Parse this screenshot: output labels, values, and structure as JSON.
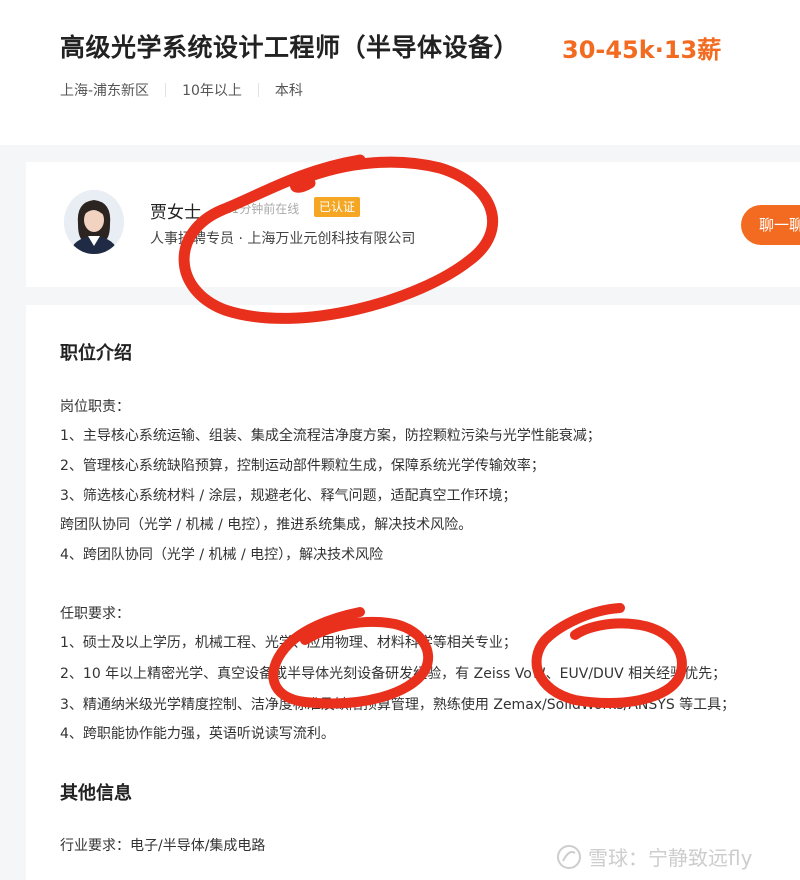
{
  "job": {
    "title": "高级光学系统设计工程师（半导体设备）",
    "salary": "30-45k·13薪",
    "location": "上海-浦东新区",
    "experience": "10年以上",
    "education": "本科"
  },
  "recruiter": {
    "name": "贾女士",
    "online_status": "21分钟前在线",
    "verified_badge": "已认证",
    "role": "人事招聘专员 · 上海万业元创科技有限公司",
    "chat_button": "聊一聊"
  },
  "description": {
    "heading": "职位介绍",
    "duties_title": "岗位职责：",
    "duties": [
      "1、主导核心系统运输、组装、集成全流程洁净度方案，防控颗粒污染与光学性能衰减；",
      "2、管理核心系统缺陷预算，控制运动部件颗粒生成，保障系统光学传输效率；",
      "3、筛选核心系统材料 / 涂层，规避老化、释气问题，适配真空工作环境；",
      "跨团队协同（光学 / 机械 / 电控），推进系统集成，解决技术风险。",
      "4、跨团队协同（光学 / 机械 / 电控），解决技术风险"
    ],
    "requirements_title": "任职要求：",
    "requirements": [
      "1、硕士及以上学历，机械工程、光学、应用物理、材料科学等相关专业；",
      "2、10 年以上精密光学、真空设备或半导体光刻设备研发经验，有 Zeiss VoW、EUV/DUV 相关经验优先；",
      "3、精通纳米级光学精度控制、洁净度标准及缺陷预算管理，熟练使用 Zemax/SolidWorks/ANSYS 等工具；",
      "4、跨职能协作能力强，英语听说读写流利。"
    ]
  },
  "other": {
    "heading": "其他信息",
    "industry": "行业要求：电子/半导体/集成电路"
  },
  "watermark": {
    "text": "雪球：宁静致远fly"
  },
  "colors": {
    "accent": "#f26b21",
    "badge": "#f5a623",
    "annotation": "#e8301c"
  }
}
